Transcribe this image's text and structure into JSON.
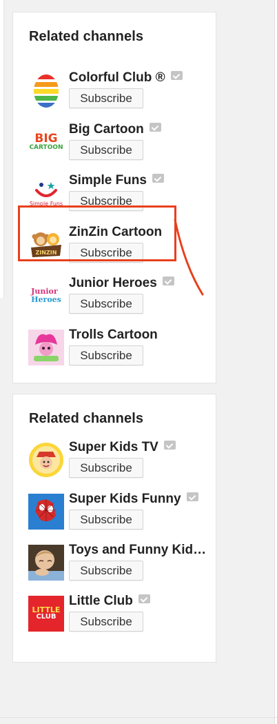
{
  "colors": {
    "page_bg": "#f1f1f1",
    "panel_bg": "#ffffff",
    "highlight": "#e8401c",
    "verified_badge": "#c5c5c5"
  },
  "panels": [
    {
      "title": "Related channels",
      "channels": [
        {
          "name": "Colorful Club ®",
          "verified": true,
          "button": "Subscribe",
          "avatar_icon": "rainbow-egg-icon"
        },
        {
          "name": "Big Cartoon",
          "verified": true,
          "button": "Subscribe",
          "avatar_icon": "big-cartoon-logo",
          "logo_text": [
            "BIG",
            "CARTOON"
          ]
        },
        {
          "name": "Simple Funs",
          "verified": true,
          "button": "Subscribe",
          "avatar_icon": "smiley-logo",
          "logo_text": "Simple Funs"
        },
        {
          "name": "ZinZin Cartoon",
          "verified": false,
          "button": "Subscribe",
          "avatar_icon": "monkey-logo",
          "logo_text": "ZINZIN",
          "highlighted": true
        },
        {
          "name": "Junior Heroes",
          "verified": true,
          "button": "Subscribe",
          "avatar_icon": "junior-heroes-logo",
          "logo_text": [
            "Junior",
            "Heroes"
          ]
        },
        {
          "name": "Trolls Cartoon",
          "verified": false,
          "button": "Subscribe",
          "avatar_icon": "troll-logo"
        }
      ]
    },
    {
      "title": "Related channels",
      "channels": [
        {
          "name": "Super Kids TV",
          "verified": true,
          "button": "Subscribe",
          "avatar_icon": "super-kids-logo"
        },
        {
          "name": "Super Kids Funny",
          "verified": true,
          "button": "Subscribe",
          "avatar_icon": "spiderman-icon"
        },
        {
          "name": "Toys and Funny Kid…",
          "verified": false,
          "button": "Subscribe",
          "avatar_icon": "child-photo-icon"
        },
        {
          "name": "Little Club",
          "verified": true,
          "button": "Subscribe",
          "avatar_icon": "little-club-logo",
          "logo_text": [
            "LITTLE",
            "CLUB"
          ]
        }
      ]
    }
  ]
}
